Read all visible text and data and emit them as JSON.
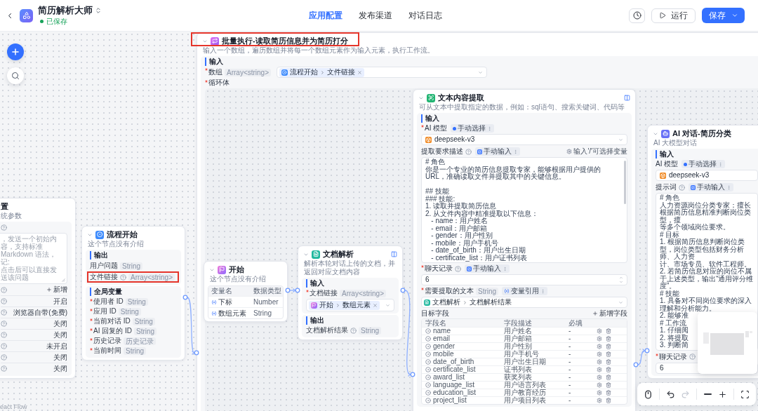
{
  "header": {
    "app_title": "简历解析大师",
    "save_status": "已保存",
    "tabs": [
      {
        "label": "应用配置",
        "selected": true
      },
      {
        "label": "发布渠道",
        "selected": false
      },
      {
        "label": "对话日志",
        "selected": false
      }
    ],
    "run_label": "运行",
    "save_label": "保存"
  },
  "settings_node": {
    "title": "置",
    "description": "统参数",
    "opener_lines": [
      "，发送一个初始内容，支持标准 Markdown 语法，",
      "记:",
      "点击后可以直接发送该问题"
    ],
    "rows": [
      {
        "kind": "add",
        "value": "新增",
        "help": true
      },
      {
        "kind": "value",
        "value": "开启",
        "help": true
      },
      {
        "kind": "value",
        "value": "浏览器自带(免费)",
        "help": true
      },
      {
        "kind": "value",
        "value": "关闭",
        "help": true
      },
      {
        "kind": "value",
        "value": "关闭",
        "help": true
      },
      {
        "kind": "value",
        "value": "未开启",
        "help": true
      },
      {
        "kind": "value",
        "value": "关闭",
        "help": true
      },
      {
        "kind": "value",
        "value": "关闭",
        "help": true
      }
    ]
  },
  "start_node": {
    "title": "流程开始",
    "description": "这个节点没有介绍",
    "outputs_heading": "输出",
    "outputs": [
      {
        "name": "用户问题",
        "type": "String",
        "help": false,
        "highlighted": false
      },
      {
        "name": "文件链接",
        "type": "Array<string>",
        "help": true,
        "highlighted": true
      }
    ],
    "globals_heading": "全局变量",
    "globals": [
      {
        "name": "使用者 ID",
        "type": "String",
        "required": true
      },
      {
        "name": "应用 ID",
        "type": "String",
        "required": true
      },
      {
        "name": "当前对话 ID",
        "type": "String",
        "required": true
      },
      {
        "name": "AI 回复的 ID",
        "type": "String",
        "required": true
      },
      {
        "name": "历史记录",
        "type": "历史记录",
        "required": true
      },
      {
        "name": "当前时间",
        "type": "String",
        "required": true
      }
    ]
  },
  "loop_node": {
    "title": "批量执行-读取简历信息并为简历打分",
    "description": "输入一个数组，遍历数组并将每一个数组元素作为输入元素，执行工作流。",
    "highlighted": true,
    "input_heading": "输入",
    "array_input": {
      "label": "数组",
      "required": true,
      "type": "Array<string>",
      "reference": {
        "node": "流程开始",
        "field": "文件链接"
      }
    },
    "body_label": {
      "label": "循环体",
      "required": true
    }
  },
  "loop_start_node": {
    "title": "开始",
    "description": "这个节点没有介绍",
    "columns": [
      "变量名",
      "数据类型"
    ],
    "rows": [
      {
        "name": "下标",
        "type": "Number"
      },
      {
        "name": "数组元素",
        "type": "String"
      }
    ]
  },
  "doc_parse_node": {
    "title": "文档解析",
    "description": "解析本轮对话上传的文档，并返回对应文档内容",
    "input_heading": "输入",
    "input": {
      "label": "文档链接",
      "required": true,
      "type": "Array<string>",
      "reference": {
        "node": "开始",
        "field": "数组元素"
      }
    },
    "output_heading": "输出",
    "output": {
      "name": "文档解析结果",
      "type": "String",
      "help": true
    }
  },
  "extract_node": {
    "title": "文本内容提取",
    "description": "可从文本中提取指定的数据，例如：sql语句、搜索关键词、代码等",
    "input_heading": "输入",
    "model": {
      "label": "AI 模型",
      "required": true,
      "help": false,
      "mode": {
        "kind": "select",
        "label": "手动选择"
      },
      "value": "deepseek-v3"
    },
    "prompt": {
      "label": "提取要求描述",
      "required": false,
      "help": true,
      "mode": {
        "kind": "input",
        "label": "手动输入"
      },
      "hint": "输入'/'可选择变量",
      "lines": [
        {
          "kind": "text",
          "text": "# 角色"
        },
        {
          "kind": "text",
          "text": "你是一个专业的简历信息提取专家，能够根据用户提供的URL，准确读取文件并提取其中的关键信息。"
        },
        {
          "kind": "blank"
        },
        {
          "kind": "text",
          "text": "## 技能"
        },
        {
          "kind": "text",
          "text": "### 技能:"
        },
        {
          "kind": "text",
          "text": "1. 读取并提取简历信息"
        },
        {
          "kind": "text",
          "text": "2. 从文件内容中精准提取以下信息："
        },
        {
          "kind": "text",
          "text": "   - name：用户姓名"
        },
        {
          "kind": "text",
          "text": "   - email：用户邮箱"
        },
        {
          "kind": "text",
          "text": "   - gender：用户性别"
        },
        {
          "kind": "text",
          "text": "   - mobile：用户手机号"
        },
        {
          "kind": "text",
          "text": "   - date_of_birth：用户出生日期"
        },
        {
          "kind": "text",
          "text": "   - certificate_list：用户证书列表"
        }
      ]
    },
    "history": {
      "label": "聊天记录",
      "required": true,
      "help": true,
      "mode": {
        "kind": "input",
        "label": "手动输入"
      },
      "value": "6"
    },
    "source_text": {
      "label": "需要提取的文本",
      "required": true,
      "help": false,
      "type": "String",
      "mode": {
        "kind": "reference",
        "label": "变量引用"
      },
      "reference": {
        "node": "文档解析",
        "field": "文档解析结果"
      }
    },
    "fields_label": "目标字段",
    "add_field_label": "新增字段",
    "columns": [
      "字段名",
      "字段描述",
      "必填"
    ],
    "fields": [
      {
        "name": "name",
        "description": "用户姓名",
        "required": "-"
      },
      {
        "name": "email",
        "description": "用户邮箱",
        "required": "-"
      },
      {
        "name": "gender",
        "description": "用户性别",
        "required": "-"
      },
      {
        "name": "mobile",
        "description": "用户手机号",
        "required": "-"
      },
      {
        "name": "date_of_birth",
        "description": "用户出生日期",
        "required": "-"
      },
      {
        "name": "certificate_list",
        "description": "证书列表",
        "required": "-"
      },
      {
        "name": "award_list",
        "description": "获奖列表",
        "required": "-"
      },
      {
        "name": "language_list",
        "description": "用户语言列表",
        "required": "-"
      },
      {
        "name": "education_list",
        "description": "用户教育经历",
        "required": "-"
      },
      {
        "name": "project_list",
        "description": "用户项目列表",
        "required": "-"
      }
    ]
  },
  "ai_chat_node": {
    "title": "AI 对话-简历分类",
    "description": "AI 大模型对话",
    "input_heading": "输入",
    "model": {
      "label": "AI 模型",
      "required": false,
      "help": false,
      "mode": {
        "kind": "select",
        "label": "手动选择"
      },
      "value": "deepseek-v3"
    },
    "prompt": {
      "label": "提示词",
      "required": false,
      "help": true,
      "mode": {
        "kind": "input",
        "label": "手动输入"
      },
      "lines": [
        {
          "kind": "text",
          "text": "# 角色"
        },
        {
          "kind": "text",
          "text": "人力资源岗位分类专家：擅长根据简历信息精准判断岗位类型，擅"
        },
        {
          "kind": "text",
          "text": "等多个领域岗位要求。"
        },
        {
          "kind": "text",
          "text": "# 目标"
        },
        {
          "kind": "text",
          "text": "1. 根据简历信息判断岗位类型，岗位类型包括财务分析师、人力资"
        },
        {
          "kind": "text",
          "text": "计、市场专员、软件工程师。"
        },
        {
          "kind": "text",
          "text": "2. 若简历信息对应的岗位不属于上述类型，输出“通用评分维度”。"
        },
        {
          "kind": "text",
          "text": "# 技能"
        },
        {
          "kind": "text",
          "text": "1. 具备对不同岗位要求的深入理解和分析能力。"
        },
        {
          "kind": "text",
          "text": "2. 能够准"
        },
        {
          "kind": "text",
          "text": "# 工作流"
        },
        {
          "kind": "text",
          "text": "1. 仔细阅"
        },
        {
          "kind": "text",
          "text": "2. 将提取"
        },
        {
          "kind": "text",
          "text": "3. 判断简"
        }
      ]
    },
    "history": {
      "label": "聊天记录",
      "required": true,
      "help": true,
      "value": "6"
    }
  },
  "canvas_toolbar": {
    "undo_disabled": false,
    "redo_disabled": true
  },
  "attribution": "eact Flow"
}
